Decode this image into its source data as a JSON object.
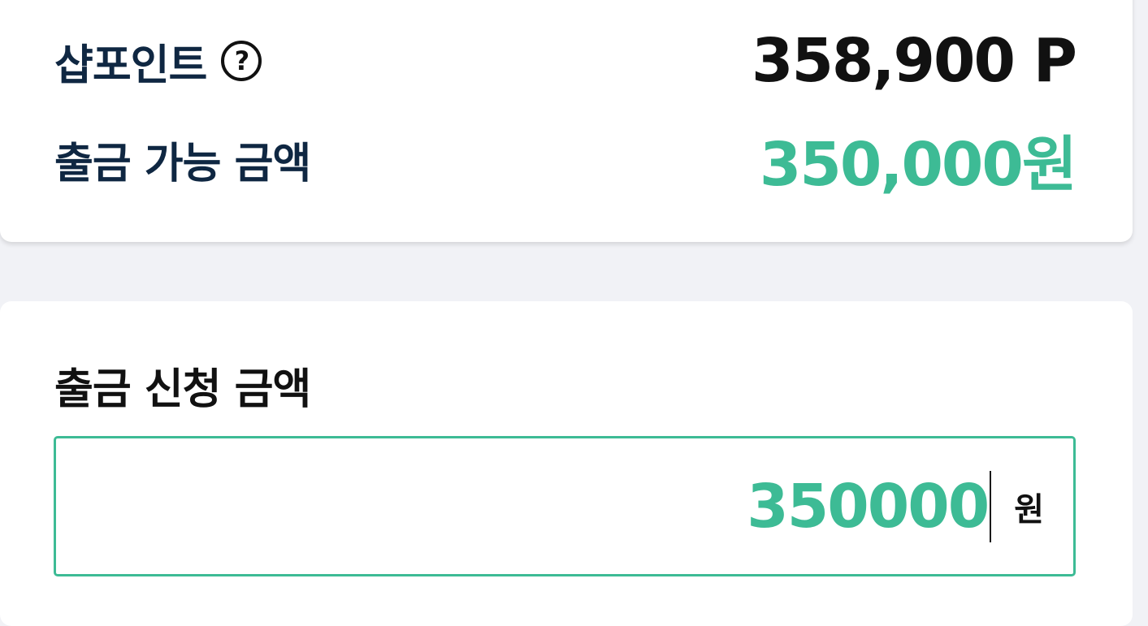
{
  "balance_card": {
    "points_label": "샵포인트",
    "help_icon": "?",
    "points_value": "358,900 P",
    "available_label": "출금 가능 금액",
    "available_value": "350,000원"
  },
  "request_card": {
    "label": "출금 신청 금액",
    "amount_value": "350000",
    "unit": "원"
  },
  "colors": {
    "accent": "#3dbb95",
    "label_dark": "#0f2742",
    "background": "#f1f2f6"
  }
}
